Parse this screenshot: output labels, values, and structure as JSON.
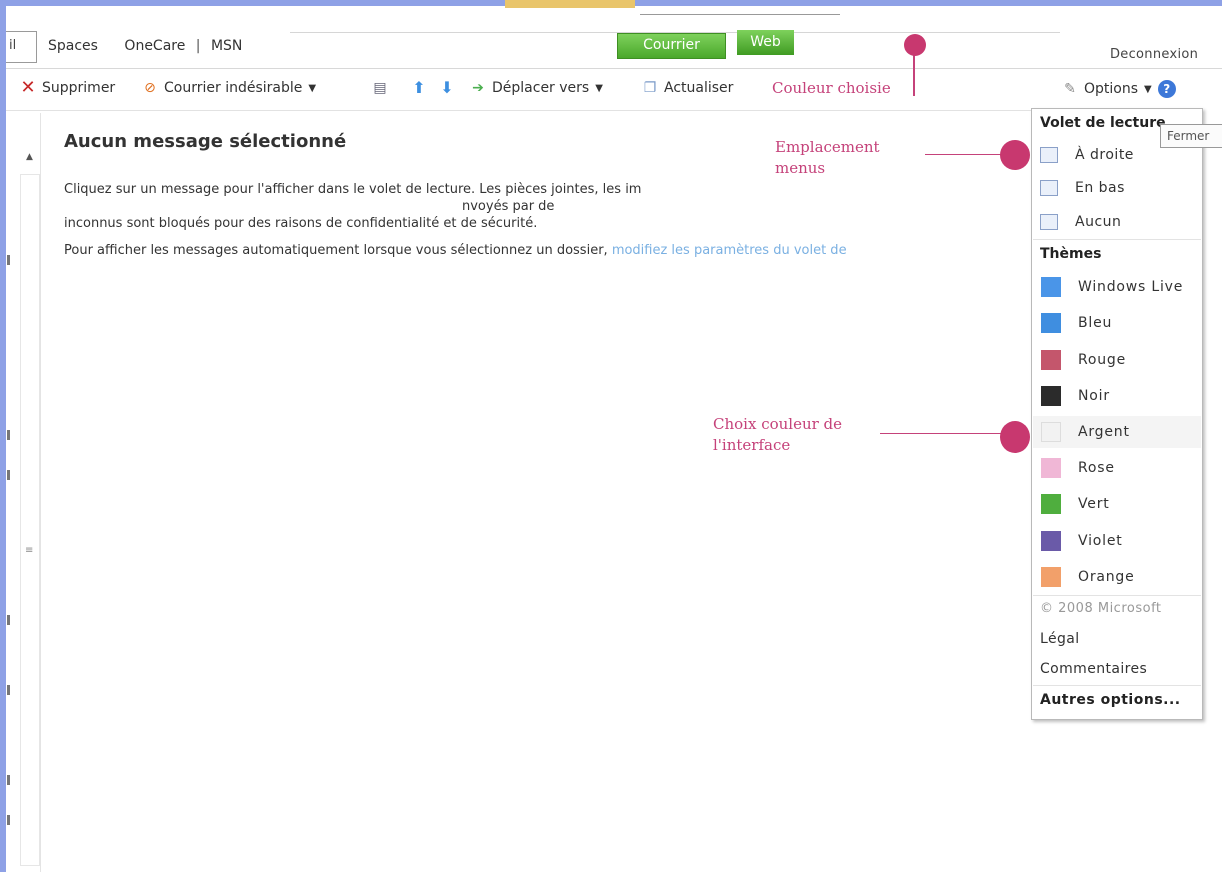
{
  "nav": {
    "cut_tab": "il",
    "items": [
      "Spaces",
      "OneCare",
      "MSN"
    ],
    "separator": "|",
    "courrier_button": "Courrier",
    "web_button": "Web",
    "deconnexion": "Deconnexion"
  },
  "toolbar": {
    "supprimer": "Supprimer",
    "courrier_indesirable": "Courrier indésirable",
    "deplacer_vers": "Déplacer vers",
    "actualiser": "Actualiser",
    "options": "Options",
    "help": "?"
  },
  "message": {
    "title": "Aucun message sélectionné",
    "body_part1": "Cliquez sur un message pour l'afficher dans le volet de lecture. Les pièces jointes, les im",
    "body_part2": "nvoyés par de",
    "body_line2": "inconnus sont bloqués pour des raisons de confidentialité et de sécurité.",
    "auto_text": "Pour afficher les messages automatiquement lorsque vous sélectionnez un dossier, ",
    "auto_link": "modifiez les paramètres du volet de"
  },
  "annotations": {
    "couleur_choisie": "Couleur choisie",
    "emplacement_line1": "Emplacement",
    "emplacement_line2": "menus",
    "choix_line1": "Choix couleur de",
    "choix_line2": "l'interface",
    "color": "#c5427a"
  },
  "menu": {
    "reading_header": "Volet de lecture",
    "reading_options": [
      "À droite",
      "En bas",
      "Aucun"
    ],
    "themes_header": "Thèmes",
    "themes": [
      {
        "label": "Windows Live",
        "color": "#4a95e8"
      },
      {
        "label": "Bleu",
        "color": "#3f8ee0"
      },
      {
        "label": "Rouge",
        "color": "#c4566c"
      },
      {
        "label": "Noir",
        "color": "#2b2b2b"
      },
      {
        "label": "Argent",
        "color": "#f2f2f2"
      },
      {
        "label": "Rose",
        "color": "#f0b7d6"
      },
      {
        "label": "Vert",
        "color": "#4fae3e"
      },
      {
        "label": "Violet",
        "color": "#6a5aa8"
      },
      {
        "label": "Orange",
        "color": "#f2a06a"
      }
    ],
    "copyright": "© 2008 Microsoft",
    "legal": "Légal",
    "comments": "Commentaires",
    "more": "Autres options..."
  },
  "tooltip": "Fermer"
}
